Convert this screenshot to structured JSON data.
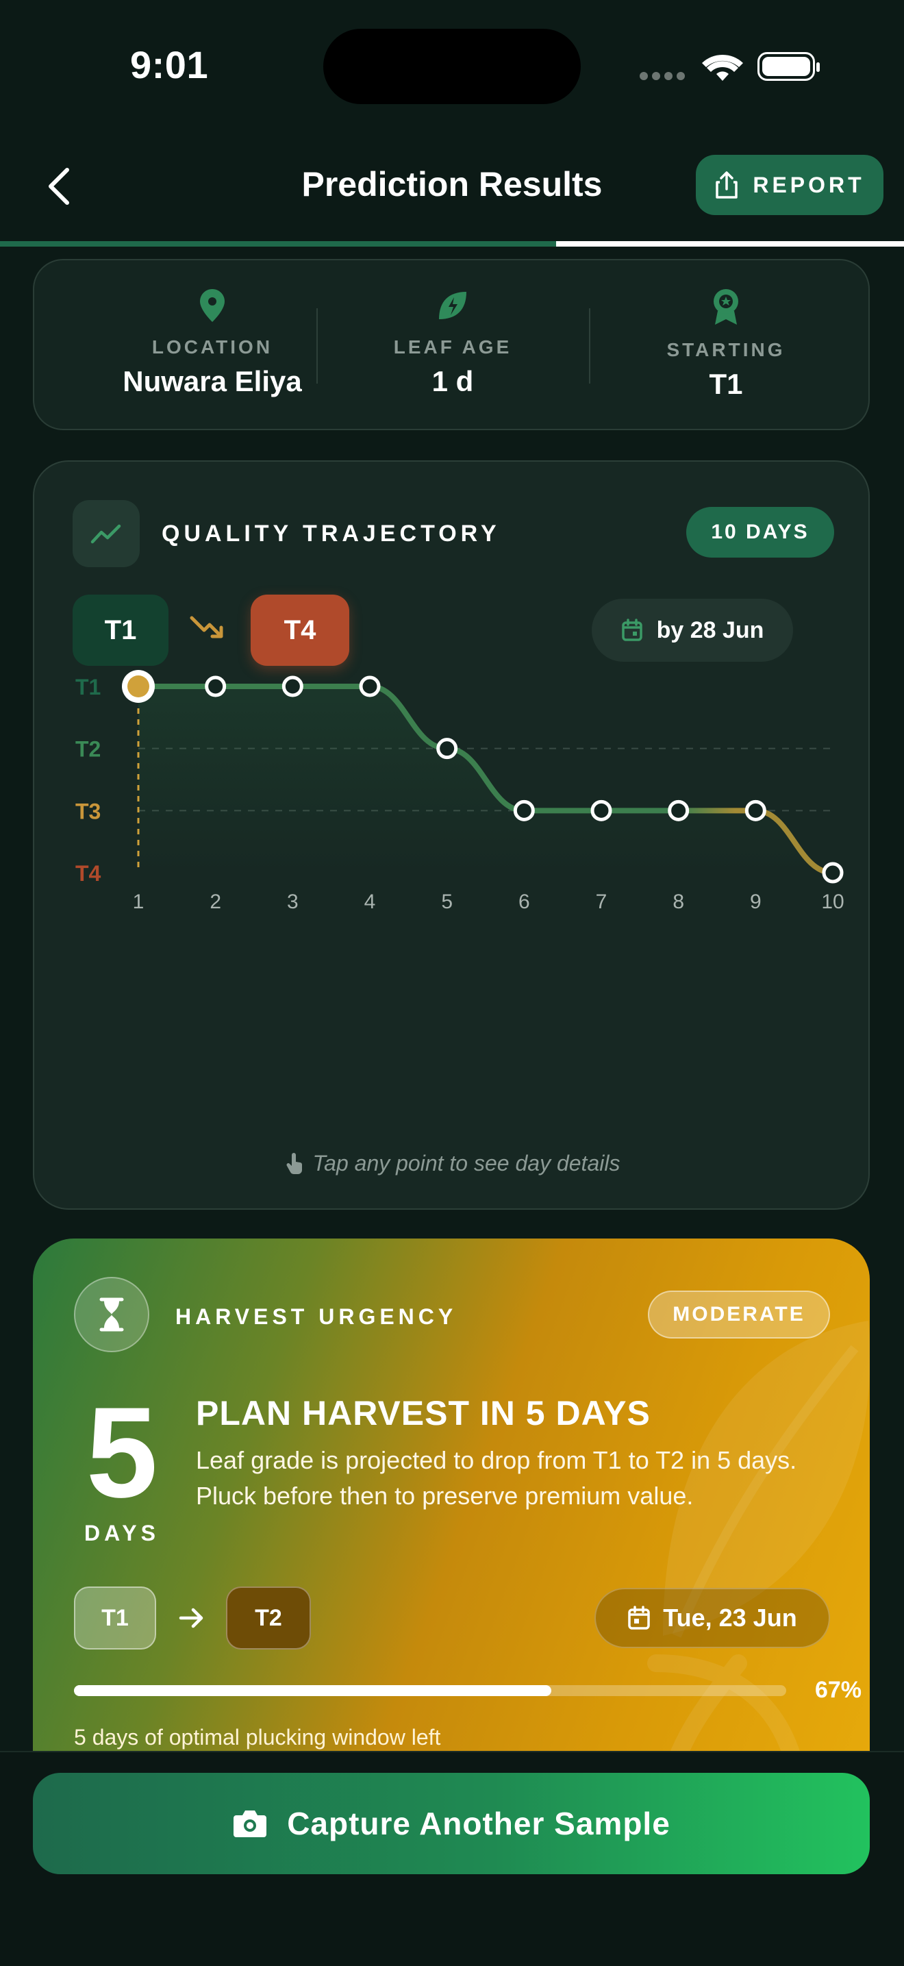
{
  "status_bar": {
    "time": "9:01"
  },
  "header": {
    "title": "Prediction Results",
    "report_label": "REPORT",
    "progress": 0.615
  },
  "info": {
    "location_label": "LOCATION",
    "location_value": "Nuwara Eliya",
    "leaf_age_label": "LEAF AGE",
    "leaf_age_value": "1 d",
    "starting_label": "STARTING",
    "starting_value": "T1"
  },
  "trajectory": {
    "title": "QUALITY TRAJECTORY",
    "days_badge": "10 DAYS",
    "from_grade": "T1",
    "to_grade": "T4",
    "by_date": "by 28 Jun",
    "hint": "Tap any point to see day details"
  },
  "chart_data": {
    "type": "line",
    "x": [
      1,
      2,
      3,
      4,
      5,
      6,
      7,
      8,
      9,
      10
    ],
    "y_categories": [
      "T1",
      "T2",
      "T3",
      "T4"
    ],
    "y": [
      "T1",
      "T1",
      "T1",
      "T1",
      "T2",
      "T3",
      "T3",
      "T3",
      "T3",
      "T4"
    ],
    "selected_day": 1,
    "grid": true,
    "colors": {
      "T1": "#1f6a4b",
      "T2": "#3a8a56",
      "T3": "#c9963a",
      "T4": "#b04a2b",
      "line": "#3c7f4e",
      "line_end": "#a38a35",
      "selected": "#d0a13a"
    }
  },
  "urgency": {
    "title": "HARVEST URGENCY",
    "badge": "MODERATE",
    "big_number": "5",
    "big_unit": "DAYS",
    "plan_title": "PLAN HARVEST IN 5 DAYS",
    "description": "Leaf grade is projected to drop from T1 to T2 in 5 days. Pluck before then to preserve premium value.",
    "from_grade": "T1",
    "to_grade": "T2",
    "date": "Tue, 23 Jun",
    "progress_value": 0.67,
    "progress_label": "67%",
    "caption": "5 days of optimal plucking window left"
  },
  "capture": {
    "label": "Capture Another Sample"
  }
}
